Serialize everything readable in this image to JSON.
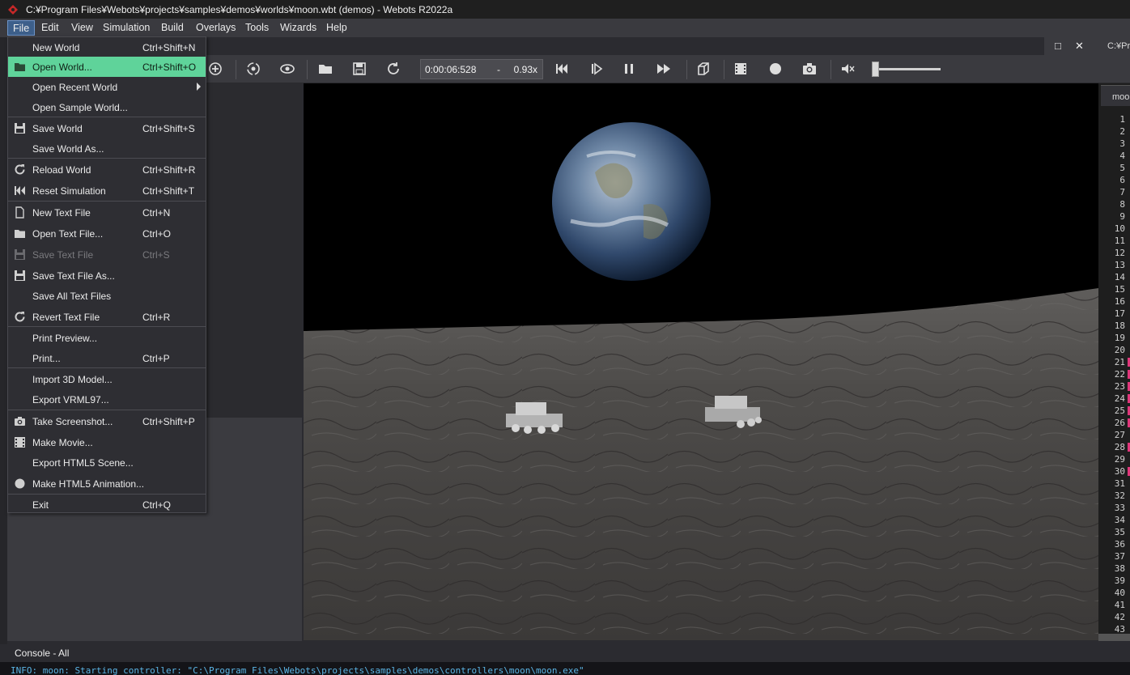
{
  "window": {
    "title": "C:¥Program Files¥Webots¥projects¥samples¥demos¥worlds¥moon.wbt (demos) - Webots R2022a"
  },
  "menubar": {
    "items": [
      "File",
      "Edit",
      "View",
      "Simulation",
      "Build",
      "Overlays",
      "Tools",
      "Wizards",
      "Help"
    ],
    "active": "File"
  },
  "doc_header": {
    "maximize": "□",
    "close": "✕",
    "path": "C:¥Pr"
  },
  "toolbar": {
    "icons": [
      "add-node-icon",
      "view-point-icon",
      "visibility-icon",
      "open-world-icon",
      "save-world-icon",
      "reload-world-icon",
      "reset-simulation-icon",
      "step-icon",
      "pause-icon",
      "fast-forward-icon",
      "rendering-icon",
      "movie-icon",
      "animation-record-icon",
      "screenshot-icon",
      "mute-icon"
    ],
    "time": "0:00:06:528",
    "time_separator": "-",
    "speed": "0.93x",
    "volume": 0.0
  },
  "file_menu": {
    "items": [
      {
        "label": "New World",
        "shortcut": "Ctrl+Shift+N",
        "icon": ""
      },
      {
        "label": "Open World...",
        "shortcut": "Ctrl+Shift+O",
        "icon": "folder-icon",
        "highlighted": true
      },
      {
        "label": "Open Recent World",
        "shortcut": "",
        "icon": "",
        "submenu": true
      },
      {
        "label": "Open Sample World...",
        "shortcut": "",
        "icon": ""
      },
      {
        "label": "Save World",
        "shortcut": "Ctrl+Shift+S",
        "icon": "floppy-icon"
      },
      {
        "label": "Save World As...",
        "shortcut": "",
        "icon": ""
      },
      {
        "label": "Reload World",
        "shortcut": "Ctrl+Shift+R",
        "icon": "reload-icon"
      },
      {
        "label": "Reset Simulation",
        "shortcut": "Ctrl+Shift+T",
        "icon": "rewind-icon"
      },
      {
        "label": "New Text File",
        "shortcut": "Ctrl+N",
        "icon": "document-icon"
      },
      {
        "label": "Open Text File...",
        "shortcut": "Ctrl+O",
        "icon": "folder-icon"
      },
      {
        "label": "Save Text File",
        "shortcut": "Ctrl+S",
        "icon": "floppy-icon",
        "disabled": true
      },
      {
        "label": "Save Text File As...",
        "shortcut": "",
        "icon": "floppy-icon"
      },
      {
        "label": "Save All Text Files",
        "shortcut": "",
        "icon": ""
      },
      {
        "label": "Revert Text File",
        "shortcut": "Ctrl+R",
        "icon": "reload-icon"
      },
      {
        "label": "Print Preview...",
        "shortcut": "",
        "icon": ""
      },
      {
        "label": "Print...",
        "shortcut": "Ctrl+P",
        "icon": ""
      },
      {
        "label": "Import 3D Model...",
        "shortcut": "",
        "icon": ""
      },
      {
        "label": "Export VRML97...",
        "shortcut": "",
        "icon": ""
      },
      {
        "label": "Take Screenshot...",
        "shortcut": "Ctrl+Shift+P",
        "icon": "camera-icon"
      },
      {
        "label": "Make Movie...",
        "shortcut": "",
        "icon": "film-icon"
      },
      {
        "label": "Export HTML5 Scene...",
        "shortcut": "",
        "icon": ""
      },
      {
        "label": "Make HTML5 Animation...",
        "shortcut": "",
        "icon": "record-icon"
      },
      {
        "label": "Exit",
        "shortcut": "Ctrl+Q",
        "icon": ""
      }
    ]
  },
  "editor": {
    "tab_label": "moon",
    "line_numbers": [
      "1",
      "2",
      "3",
      "4",
      "5",
      "6",
      "7",
      "8",
      "9",
      "10",
      "11",
      "12",
      "13",
      "14",
      "15",
      "16",
      "17",
      "18",
      "19",
      "20",
      "21",
      "22",
      "23",
      "24",
      "25",
      "26",
      "27",
      "28",
      "29",
      "30",
      "31",
      "32",
      "33",
      "34",
      "35",
      "36",
      "37",
      "38",
      "39",
      "40",
      "41",
      "42",
      "43"
    ],
    "accent_color": "#e0367a"
  },
  "console": {
    "title": "Console - All",
    "line": "INFO: moon: Starting controller: \"C:\\Program Files\\Webots\\projects\\samples\\demos\\controllers\\moon\\moon.exe\""
  }
}
